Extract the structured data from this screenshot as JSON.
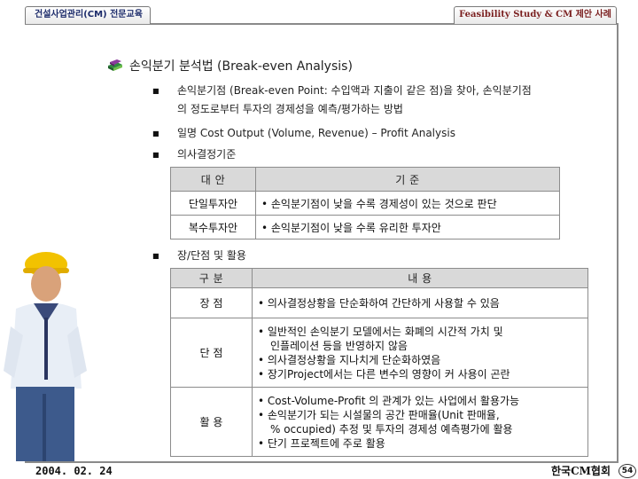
{
  "header": {
    "left_tab": "건설사업관리(CM) 전문교육",
    "right_tab": "Feasibility Study & CM 제안 사례"
  },
  "title": "손익분기 분석법 (Break-even Analysis)",
  "bullets": {
    "b1_line1": "손익분기점 (Break-even Point: 수입액과 지출이 같은 점)을 찾아, 손익분기점",
    "b1_line2": "의 정도로부터 투자의 경제성을 예측/평가하는 방법",
    "b2": "일명 Cost Output (Volume, Revenue) – Profit Analysis",
    "b3": "의사결정기준",
    "b4": "장/단점 및 활용"
  },
  "table1": {
    "headers": [
      "대 안",
      "기 준"
    ],
    "rows": [
      {
        "label": "단일투자안",
        "content": "• 손익분기점이 낮을 수록 경제성이 있는 것으로 판단"
      },
      {
        "label": "복수투자안",
        "content": "• 손익분기점이 낮을 수록 유리한 투자안"
      }
    ]
  },
  "table2": {
    "headers": [
      "구 분",
      "내 용"
    ],
    "rows": [
      {
        "label": "장 점",
        "lines": [
          "• 의사결정상황을 단순화하여 간단하게 사용할 수 있음"
        ]
      },
      {
        "label": "단 점",
        "lines": [
          "• 일반적인 손익분기 모델에서는 화폐의 시간적 가치 및",
          "인플레이션 등을 반영하지 않음",
          "• 의사결정상황을 지나치게 단순화하였음",
          "• 장기Project에서는 다른 변수의 영향이 커 사용이 곤란"
        ]
      },
      {
        "label": "활 용",
        "lines": [
          "• Cost-Volume-Profit 의 관계가 있는 사업에서 활용가능",
          "• 손익분기가 되는 시설물의 공간 판매율(Unit 판매율,",
          "% occupied) 추정 및 투자의 경제성 예측평가에 활용",
          "• 단기 프로젝트에 주로 활용"
        ]
      }
    ]
  },
  "footer": {
    "date": "2004. 02. 24",
    "org": "한국CM협회",
    "page": "54"
  },
  "colors": {
    "table_header_bg": "#d9d9d9",
    "frame": "#8a8a8a"
  },
  "icons": {
    "title": "book-stack-icon",
    "illustration": "engineer-hardhat-illustration"
  }
}
